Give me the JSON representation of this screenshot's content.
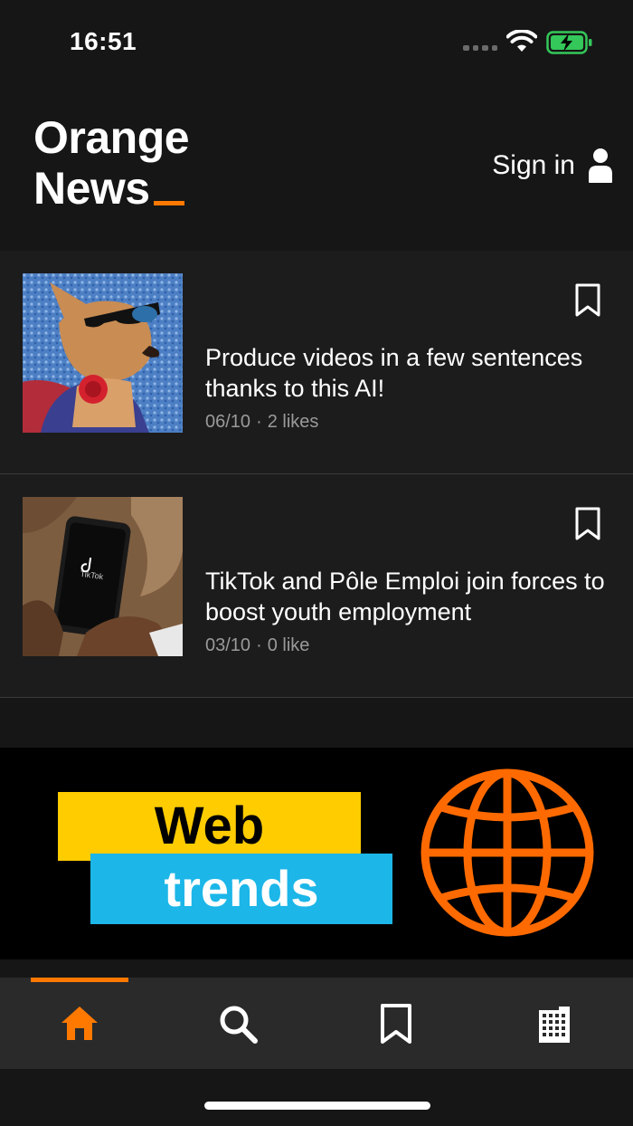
{
  "status_bar": {
    "time": "16:51",
    "icons": [
      "signal-dots-icon",
      "wifi-icon",
      "battery-charging-icon"
    ],
    "battery_color": "#34c759"
  },
  "header": {
    "brand_line1": "Orange",
    "brand_line2": "News",
    "signin_label": "Sign in",
    "accent_color": "#ff7900"
  },
  "articles": [
    {
      "title": "Produce videos in a few sentences thanks to this AI!",
      "date": "06/10",
      "likes": "2 likes",
      "thumbnail": "dog-with-sunglasses-image"
    },
    {
      "title": "TikTok and Pôle Emploi join forces to boost youth employment",
      "date": "03/10",
      "likes": "0 like",
      "thumbnail": "phone-with-tiktok-image",
      "thumbnail_text": "TikTok"
    }
  ],
  "banner": {
    "line1": "Web",
    "line2": "trends",
    "yellow": "#ffcc00",
    "blue": "#1cb6e8",
    "globe_color": "#ff6a00"
  },
  "tab_bar": {
    "tabs": [
      {
        "name": "home",
        "icon": "home-icon",
        "active": true
      },
      {
        "name": "search",
        "icon": "search-icon",
        "active": false
      },
      {
        "name": "bookmarks",
        "icon": "bookmark-icon",
        "active": false
      },
      {
        "name": "company",
        "icon": "building-icon",
        "active": false
      }
    ]
  }
}
